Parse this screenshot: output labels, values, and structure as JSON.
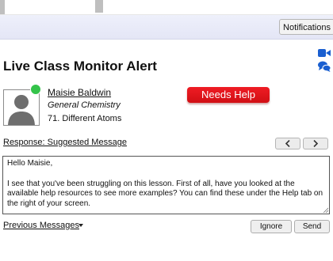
{
  "header": {
    "notifications_label": "Notifications"
  },
  "alert": {
    "title": "Live Class Monitor Alert",
    "student": {
      "name": "Maisie Baldwin",
      "course": "General Chemistry",
      "lesson": "71. Different Atoms",
      "status_color": "#34c34a"
    },
    "status_badge": "Needs Help",
    "status_badge_color": "#e0141a"
  },
  "response": {
    "label": "Response: Suggested Message",
    "message_greeting": "Hello Maisie,",
    "message_body": "I see that you've been struggling on this lesson. First of all, have you looked at the available help resources to see more examples? You can find these under the Help tab on the right of your screen."
  },
  "footer": {
    "previous_messages_label": "Previous Messages",
    "ignore_label": "Ignore",
    "send_label": "Send"
  },
  "icons": {
    "video": "video-camera-icon",
    "chat": "chat-bubbles-icon",
    "prev": "chevron-left-icon",
    "next": "chevron-right-icon",
    "dropdown": "caret-down-icon"
  },
  "colors": {
    "accent_blue": "#1a5fd0",
    "header_band": "#e8eaf8"
  }
}
